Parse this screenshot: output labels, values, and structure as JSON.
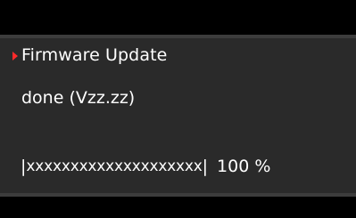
{
  "menu": {
    "title": "Firmware Update",
    "status": "done (Vzz.zz)"
  },
  "progress": {
    "left_edge": "|",
    "bar_text": "xxxxxxxxxxxxxxxxxxxx",
    "right_edge": "|",
    "percent_label": "100 %",
    "value_percent": 100
  },
  "icons": {
    "selection_marker": "caret-right-icon"
  },
  "colors": {
    "background": "#000000",
    "panel": "#2a2a2a",
    "divider": "#3c3c3c",
    "text": "#ffffff",
    "accent": "#ff2a2a"
  }
}
